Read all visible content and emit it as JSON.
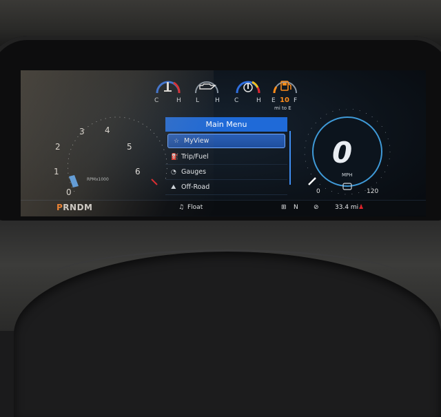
{
  "top_gauges": [
    {
      "icon": "coolant-temp-icon",
      "left": "C",
      "right": "H"
    },
    {
      "icon": "oil-pressure-icon",
      "left": "L",
      "right": "H"
    },
    {
      "icon": "trans-temp-icon",
      "left": "C",
      "right": "H"
    },
    {
      "icon": "fuel-icon",
      "left": "E",
      "right": "F",
      "value": "10",
      "unit": "mi to E"
    }
  ],
  "tachometer": {
    "ticks": [
      "0",
      "1",
      "2",
      "3",
      "4",
      "5",
      "6"
    ],
    "label": "RPMx1000"
  },
  "menu": {
    "title": "Main Menu",
    "items": [
      {
        "label": "MyView",
        "icon": "star-icon"
      },
      {
        "label": "Trip/Fuel",
        "icon": "fuel-pump-icon"
      },
      {
        "label": "Gauges",
        "icon": "gauge-icon"
      },
      {
        "label": "Off-Road",
        "icon": "off-road-icon"
      }
    ],
    "selected_index": 0
  },
  "speedometer": {
    "value": "0",
    "unit": "MPH",
    "min": "0",
    "max": "120"
  },
  "status_bar": {
    "gear_active": "P",
    "gear_rest": "RNDM",
    "media": "Float",
    "drive_mode": "N",
    "range": "33.4 mi"
  },
  "colors": {
    "accent_blue": "#1f6ad8",
    "gear_orange": "#ff7a1a",
    "fuel_warning": "#ff8c1a",
    "alert_red": "#e0242b"
  }
}
